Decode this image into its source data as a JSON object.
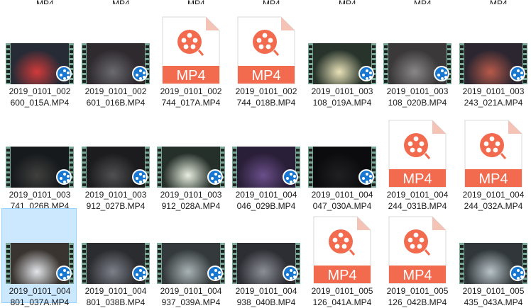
{
  "colors": {
    "selection_bg": "#cce8ff",
    "selection_border": "#99d1ff",
    "mp4_accent": "#f26b4f",
    "film_strip": "#7aa898",
    "player_badge": "#1877d1"
  },
  "files": [
    {
      "line1": "2019_0101_002",
      "line2": "600_015A.MP4",
      "type": "video",
      "frame": "#262b35",
      "glow": "#d23a3a",
      "selected": false
    },
    {
      "line1": "2019_0101_002",
      "line2": "601_016B.MP4",
      "type": "video",
      "frame": "#2e2a2e",
      "glow": "#6a6a70",
      "selected": false
    },
    {
      "line1": "2019_0101_002",
      "line2": "744_017A.MP4",
      "type": "mp4",
      "doc_label": "MP4",
      "selected": false
    },
    {
      "line1": "2019_0101_002",
      "line2": "744_018B.MP4",
      "type": "mp4",
      "doc_label": "MP4",
      "selected": false
    },
    {
      "line1": "2019_0101_003",
      "line2": "108_019A.MP4",
      "type": "video",
      "frame": "#27332b",
      "glow": "#e9e2b8",
      "selected": false
    },
    {
      "line1": "2019_0101_003",
      "line2": "108_020B.MP4",
      "type": "video",
      "frame": "#3a3838",
      "glow": "#8a8788",
      "selected": false
    },
    {
      "line1": "2019_0101_003",
      "line2": "243_021A.MP4",
      "type": "video",
      "frame": "#2b2630",
      "glow": "#b85a4a",
      "selected": false
    },
    {
      "line1": "2019_0101_003",
      "line2": "741_026B.MP4",
      "type": "video",
      "frame": "#161a1c",
      "glow": "#40403e",
      "selected": false
    },
    {
      "line1": "2019_0101_003",
      "line2": "912_027B.MP4",
      "type": "video",
      "frame": "#1c1c1e",
      "glow": "#505052",
      "selected": false
    },
    {
      "line1": "2019_0101_003",
      "line2": "912_028A.MP4",
      "type": "video",
      "frame": "#26302a",
      "glow": "#e8eee0",
      "selected": false
    },
    {
      "line1": "2019_0101_004",
      "line2": "046_029B.MP4",
      "type": "video",
      "frame": "#2a1f38",
      "glow": "#6a4f8a",
      "selected": false
    },
    {
      "line1": "2019_0101_004",
      "line2": "047_030A.MP4",
      "type": "video",
      "frame": "#0c0c0e",
      "glow": "#202022",
      "selected": false
    },
    {
      "line1": "2019_0101_004",
      "line2": "244_031B.MP4",
      "type": "mp4",
      "doc_label": "MP4",
      "selected": false
    },
    {
      "line1": "2019_0101_004",
      "line2": "244_032A.MP4",
      "type": "mp4",
      "doc_label": "MP4",
      "selected": false
    },
    {
      "line1": "2019_0101_004",
      "line2": "801_037A.MP4",
      "type": "video",
      "frame": "#3a3430",
      "glow": "#e2e6ea",
      "selected": true
    },
    {
      "line1": "2019_0101_004",
      "line2": "801_038B.MP4",
      "type": "video",
      "frame": "#2a2c30",
      "glow": "#7c8088",
      "selected": false
    },
    {
      "line1": "2019_0101_004",
      "line2": "937_039A.MP4",
      "type": "video",
      "frame": "#343a3c",
      "glow": "#a9b3b6",
      "selected": false
    },
    {
      "line1": "2019_0101_004",
      "line2": "938_040B.MP4",
      "type": "video",
      "frame": "#2c2e34",
      "glow": "#8c8f96",
      "selected": false
    },
    {
      "line1": "2019_0101_005",
      "line2": "126_041A.MP4",
      "type": "mp4",
      "doc_label": "MP4",
      "selected": false
    },
    {
      "line1": "2019_0101_005",
      "line2": "126_042B.MP4",
      "type": "mp4",
      "doc_label": "MP4",
      "selected": false
    },
    {
      "line1": "2019_0101_005",
      "line2": "435_043A.MP4",
      "type": "video",
      "frame": "#30363a",
      "glow": "#b8c4c8",
      "selected": false
    }
  ],
  "partial_top_row": [
    "..._MP4",
    "..._MP4",
    "..._MP4",
    "..._MP4",
    "..._MP4",
    "..._MP4",
    "..._MP4"
  ]
}
